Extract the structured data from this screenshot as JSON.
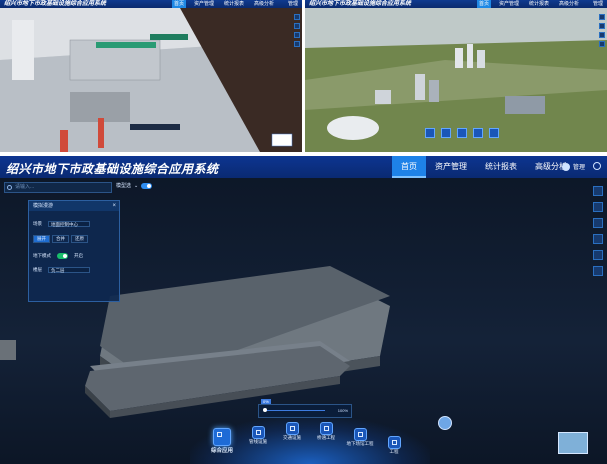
{
  "app": {
    "title": "绍兴市地下市政基础设施综合应用系统",
    "tabs": [
      "首页",
      "资产管理",
      "统计报表",
      "高级分析"
    ],
    "active_tab": "首页",
    "user": "管理"
  },
  "small_headers": {
    "title": "绍兴市地下市政基础设施综合应用系统",
    "tabs": [
      "首页",
      "资产管理",
      "统计报表",
      "高级分析"
    ],
    "user": "管理"
  },
  "toolbar": {
    "search_placeholder": "请输入...",
    "filter_label": "模型选",
    "filter_on": true
  },
  "dialog": {
    "title": "模拟漫游",
    "close": "×",
    "area_label": "场景",
    "area_value": "地面控制中心",
    "mode_buttons": [
      "展开",
      "合并",
      "还原"
    ],
    "active_mode": "展开",
    "underground_label": "地下模式",
    "underground_value": "开启",
    "floor_label": "楼层",
    "floor_value": "负二层"
  },
  "slider": {
    "low_label": "0%",
    "high_label": "100%"
  },
  "dock": {
    "items": [
      {
        "label": "综合应用",
        "icon": "grid-icon"
      },
      {
        "label": "管线设施",
        "icon": "pipe-icon"
      },
      {
        "label": "交通设施",
        "icon": "metro-icon"
      },
      {
        "label": "桥涵工程",
        "icon": "bridge-icon"
      },
      {
        "label": "地下场馆工程",
        "icon": "hall-icon"
      },
      {
        "label": "工程",
        "icon": "site-icon"
      }
    ]
  },
  "colors": {
    "header": "#0d3591",
    "accent": "#1e82e8",
    "background": "#0b1a2e"
  }
}
